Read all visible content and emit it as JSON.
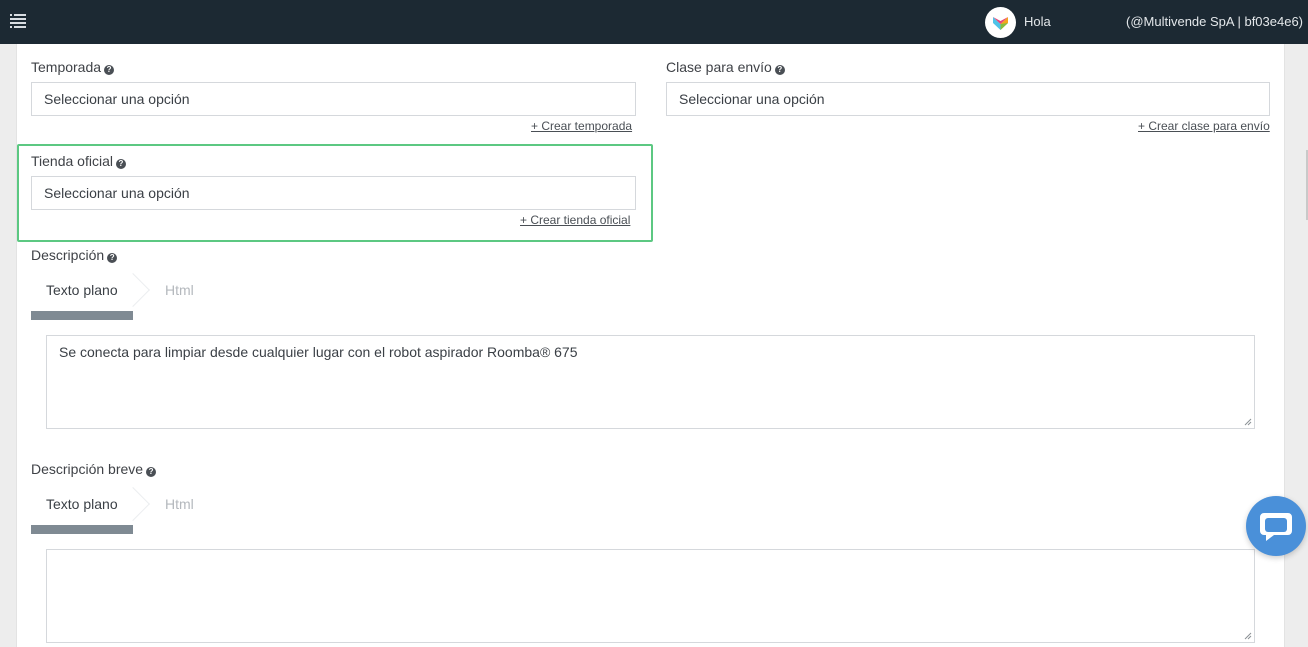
{
  "header": {
    "greeting": "Hola",
    "account_label": "(@Multivende SpA | bf03e4e6)",
    "menu_icon": "hamburger-menu-icon",
    "account_chevron": "chevron-down-icon"
  },
  "form": {
    "temporada": {
      "label": "Temporada",
      "placeholder": "Seleccionar una opción",
      "create_link": "+ Crear temporada"
    },
    "clase_envio": {
      "label": "Clase para envío",
      "placeholder": "Seleccionar una opción",
      "create_link": "+ Crear clase para envío"
    },
    "tienda_oficial": {
      "label": "Tienda oficial",
      "placeholder": "Seleccionar una opción",
      "create_link": "+ Crear tienda oficial"
    },
    "descripcion": {
      "label": "Descripción",
      "tabs": [
        "Texto plano",
        "Html"
      ],
      "active_tab": "Texto plano",
      "value": "Se conecta para limpiar desde cualquier lugar con el robot aspirador Roomba® 675"
    },
    "descripcion_breve": {
      "label": "Descripción breve",
      "tabs": [
        "Texto plano",
        "Html"
      ],
      "active_tab": "Texto plano",
      "value": ""
    }
  },
  "colors": {
    "topbar": "#1c2933",
    "highlight": "#5cc882",
    "tab_underline": "#7f8a93",
    "chat_button": "#4a90d9"
  },
  "chat": {
    "icon": "chat-bubble-icon"
  }
}
